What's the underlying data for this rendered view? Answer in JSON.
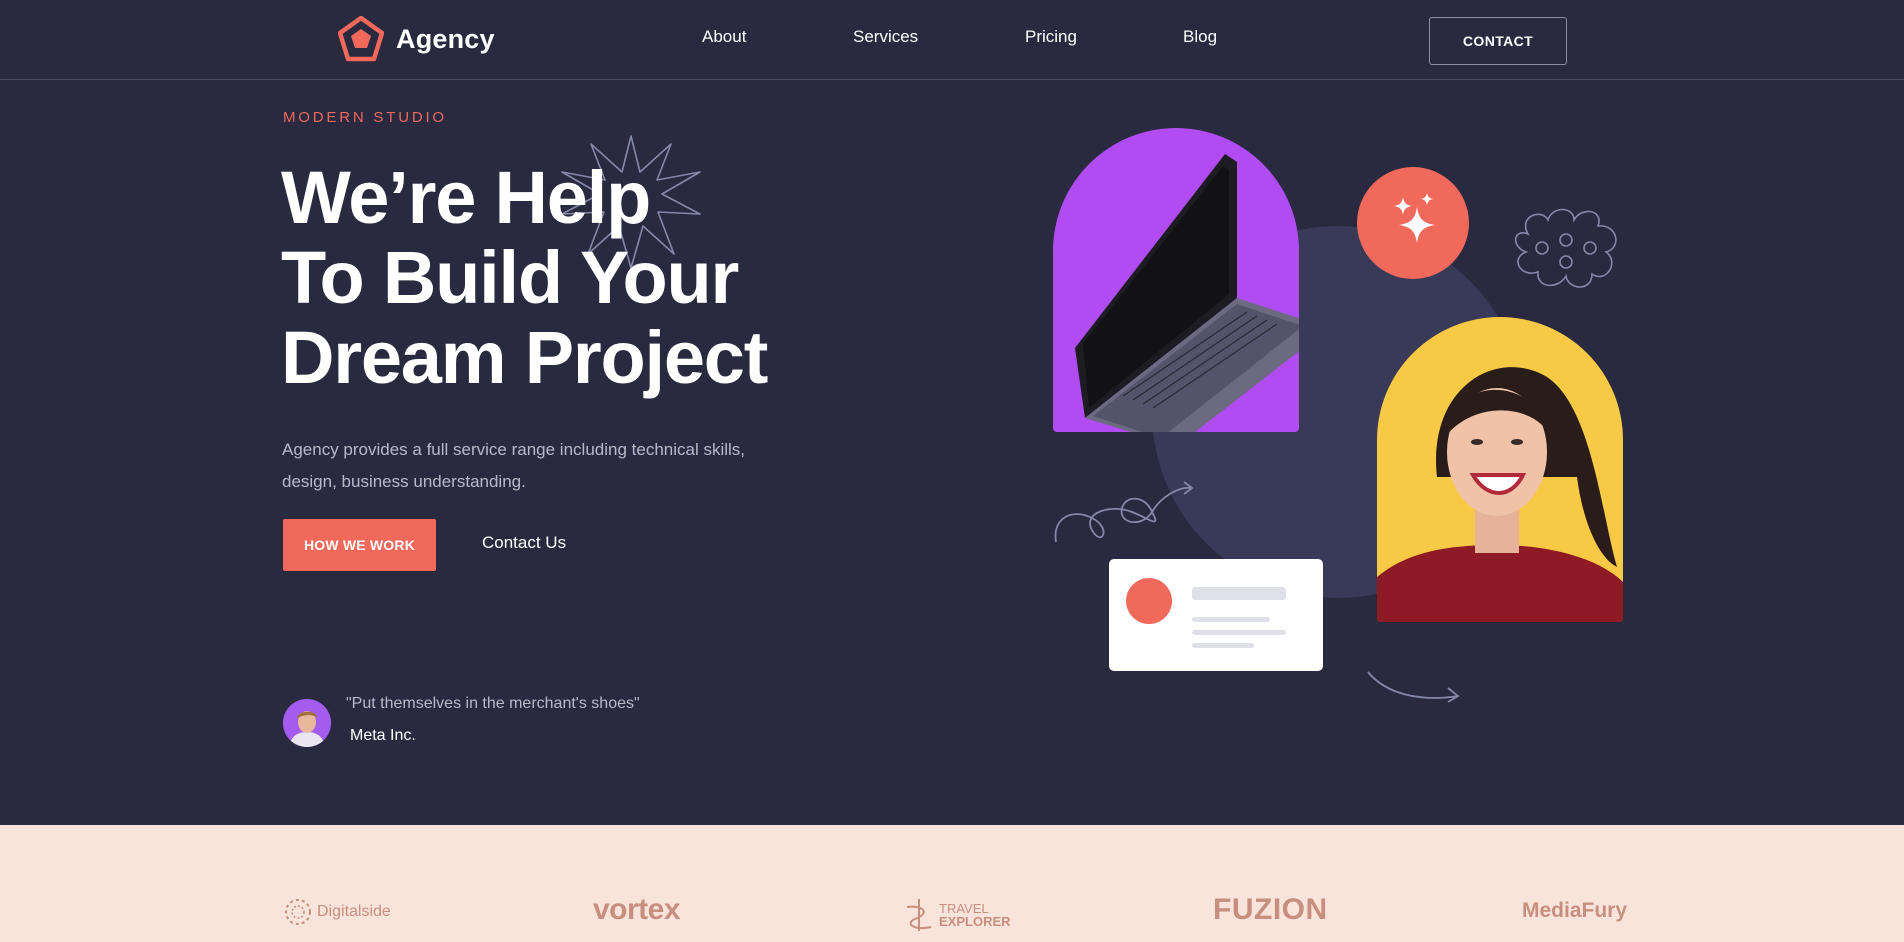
{
  "nav": {
    "brand": "Agency",
    "links": [
      "About",
      "Services",
      "Pricing",
      "Blog"
    ],
    "contact_label": "CONTACT"
  },
  "hero": {
    "eyebrow": "MODERN STUDIO",
    "headline_lines": [
      "We’re Help",
      "To Build Your",
      "Dream Project"
    ],
    "description": "Agency provides a full service range including technical skills, design, business understanding.",
    "primary_cta": "HOW WE WORK",
    "secondary_cta": "Contact Us",
    "testimonial": {
      "quote": "\"Put themselves in the merchant's shoes\"",
      "company": "Meta Inc."
    }
  },
  "brands": {
    "items": [
      "Digitalside",
      "vortex",
      "TRAVEL",
      "EXPLORER",
      "FUZION",
      "MediaFury"
    ]
  },
  "colors": {
    "background": "#292a40",
    "accent": "#f0695a",
    "purple": "#b14bf2",
    "yellow": "#f7c944",
    "strip": "#f9e4dc"
  }
}
